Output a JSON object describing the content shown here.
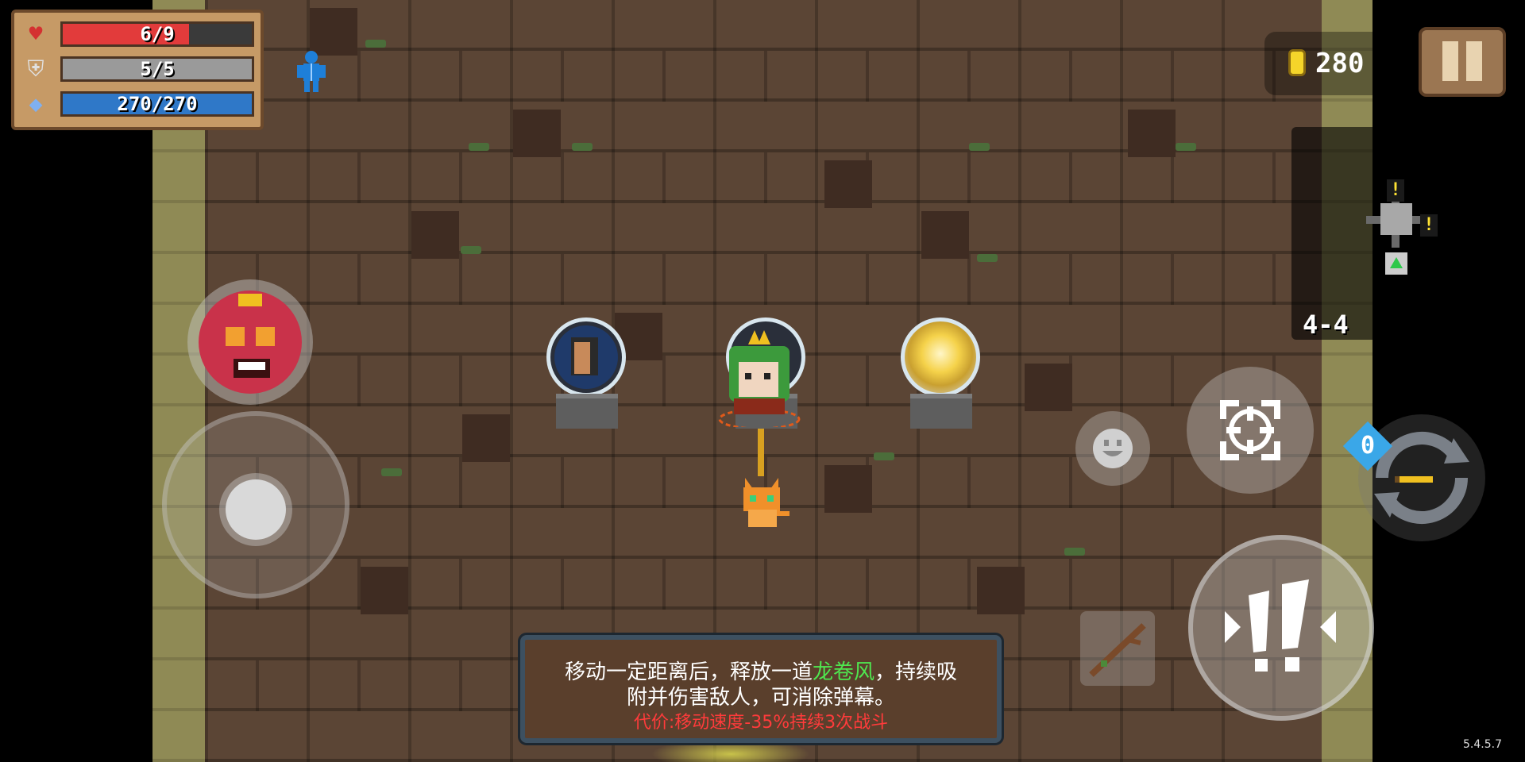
{
  "hud": {
    "hp": {
      "text": "6/9",
      "value": 6,
      "max": 9,
      "color": "#e23b3b",
      "icon": "heart-icon"
    },
    "armor": {
      "text": "5/5",
      "value": 5,
      "max": 5,
      "color": "#9a9a9a",
      "icon": "shield-icon"
    },
    "energy": {
      "text": "270/270",
      "value": 270,
      "max": 270,
      "color": "#2f78c8",
      "icon": "energy-diamond-icon"
    },
    "coins": "280",
    "level": "4-4",
    "version": "5.4.5.7"
  },
  "tooltip": {
    "line1_a": "移动一定距离后，释放一道",
    "line1_highlight": "龙卷风",
    "line1_b": "，持续吸",
    "line2": "附并伤害敌人，可消除弹幕。",
    "cost": "代价:移动速度-35%持续3次战斗"
  },
  "skill": {
    "charges": "0"
  },
  "icons": {
    "pause": "pause-icon",
    "buff": "ghost-buff-icon",
    "minimap_warning": "!",
    "emote": "smiley-icon",
    "target": "crosshair-icon",
    "attack": "attack-burst-icon",
    "weapon": "staff-icon",
    "swap": "swap-weapon-icon"
  }
}
